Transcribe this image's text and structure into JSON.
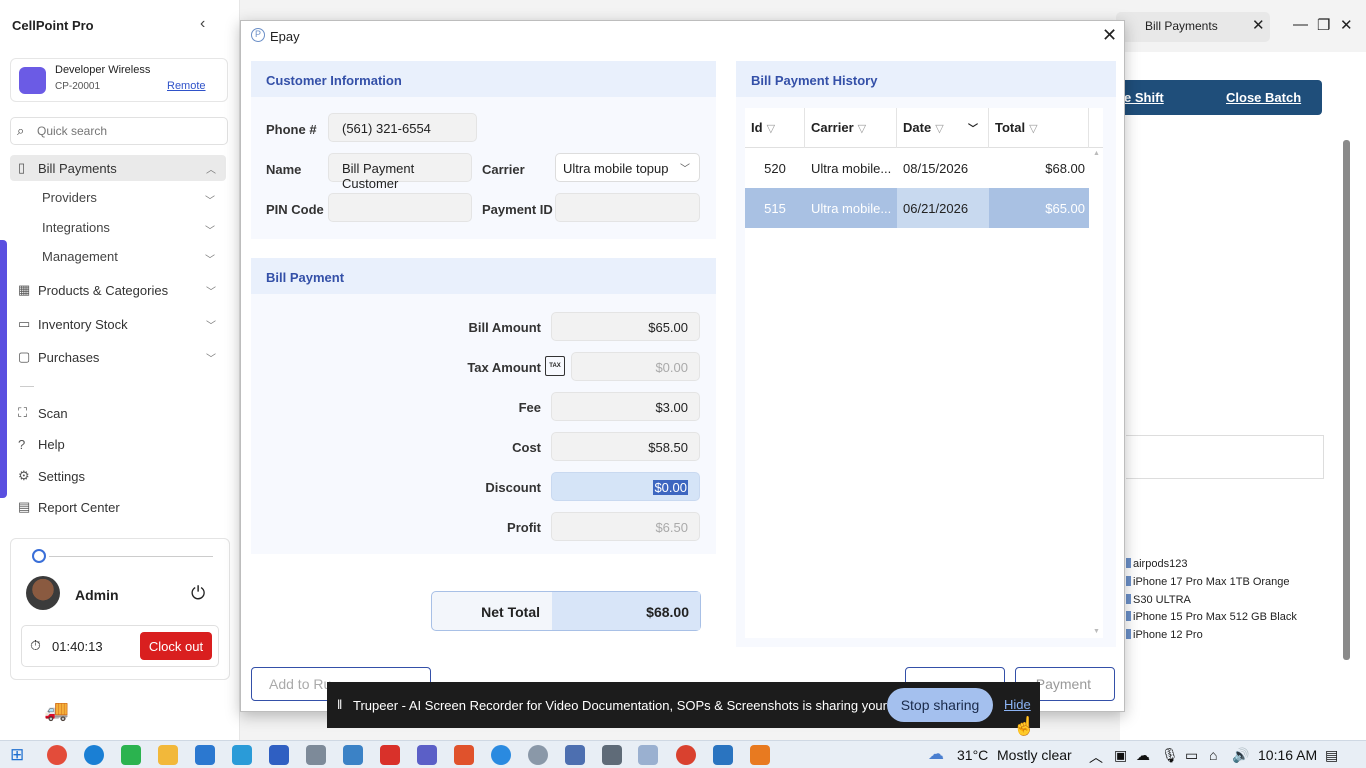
{
  "app": {
    "title": "CellPoint Pro"
  },
  "store": {
    "name": "Developer Wireless",
    "id": "CP-20001",
    "remote": "Remote"
  },
  "search": {
    "placeholder": "Quick search"
  },
  "nav": {
    "bill_payments": "Bill Payments",
    "providers": "Providers",
    "integrations": "Integrations",
    "management": "Management",
    "products": "Products & Categories",
    "inventory": "Inventory Stock",
    "purchases": "Purchases",
    "scan": "Scan",
    "help": "Help",
    "settings": "Settings",
    "report": "Report Center"
  },
  "user": {
    "name": "Admin",
    "time": "01:40:13",
    "clock_out": "Clock out"
  },
  "bg": {
    "tab_label": "Bill Payments",
    "shift_link": "e Shift",
    "close_batch": "Close Batch",
    "products": [
      "airpods123",
      "iPhone 17 Pro Max 1TB Orange",
      "S30 ULTRA",
      "iPhone 15 Pro Max 512 GB Black",
      "iPhone 12 Pro"
    ]
  },
  "dialog": {
    "title": "Epay",
    "customer": {
      "header": "Customer Information",
      "phone_label": "Phone #",
      "phone": "(561) 321-6554",
      "name_label": "Name",
      "name": "Bill Payment Customer",
      "carrier_label": "Carrier",
      "carrier": "Ultra mobile topup",
      "pin_label": "PIN Code",
      "pin": "",
      "payment_id_label": "Payment ID",
      "payment_id": ""
    },
    "bill": {
      "header": "Bill Payment",
      "bill_amount_label": "Bill Amount",
      "bill_amount": "$65.00",
      "tax_label": "Tax Amount",
      "tax_icon_text": "TAX",
      "tax": "$0.00",
      "fee_label": "Fee",
      "fee": "$3.00",
      "cost_label": "Cost",
      "cost": "$58.50",
      "discount_label": "Discount",
      "discount": "$0.00",
      "profit_label": "Profit",
      "profit": "$6.50",
      "net_label": "Net Total",
      "net": "$68.00"
    },
    "history": {
      "header": "Bill Payment History",
      "columns": {
        "id": "Id",
        "carrier": "Carrier",
        "date": "Date",
        "total": "Total"
      },
      "rows": [
        {
          "id": "520",
          "carrier": "Ultra mobile...",
          "date": "08/15/2026",
          "total": "$68.00"
        },
        {
          "id": "515",
          "carrier": "Ultra mobile...",
          "date": "06/21/2026",
          "total": "$65.00"
        }
      ]
    },
    "buttons": {
      "add_to_run": "Add to Ru",
      "payment": "Payment"
    }
  },
  "share": {
    "text": "Trupeer - AI Screen Recorder for Video Documentation, SOPs & Screenshots is sharing your screen.",
    "stop": "Stop sharing",
    "hide": "Hide"
  },
  "taskbar": {
    "weather": "31°C",
    "weather_desc": "Mostly clear",
    "time": "10:16 AM"
  }
}
